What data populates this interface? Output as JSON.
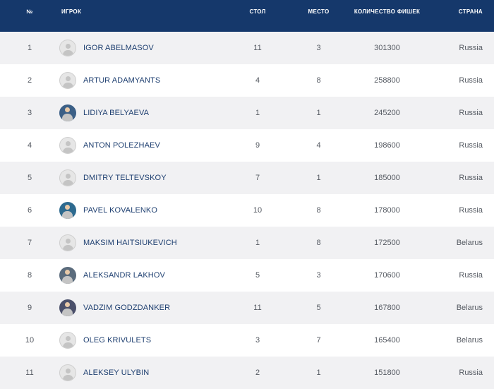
{
  "headers": {
    "rank": "№",
    "player": "ИГРОК",
    "table": "СТОЛ",
    "seat": "МЕСТО",
    "chips": "КОЛИЧЕСТВО ФИШЕК",
    "country": "СТРАНА"
  },
  "rows": [
    {
      "rank": "1",
      "name": "IGOR ABELMASOV",
      "table": "11",
      "seat": "3",
      "chips": "301300",
      "country": "Russia",
      "avatar": "placeholder"
    },
    {
      "rank": "2",
      "name": "ARTUR ADAMYANTS",
      "table": "4",
      "seat": "8",
      "chips": "258800",
      "country": "Russia",
      "avatar": "placeholder"
    },
    {
      "rank": "3",
      "name": "LIDIYA BELYAEVA",
      "table": "1",
      "seat": "1",
      "chips": "245200",
      "country": "Russia",
      "avatar": "photo"
    },
    {
      "rank": "4",
      "name": "ANTON POLEZHAEV",
      "table": "9",
      "seat": "4",
      "chips": "198600",
      "country": "Russia",
      "avatar": "placeholder"
    },
    {
      "rank": "5",
      "name": "DMITRY TELTEVSKOY",
      "table": "7",
      "seat": "1",
      "chips": "185000",
      "country": "Russia",
      "avatar": "placeholder"
    },
    {
      "rank": "6",
      "name": "PAVEL KOVALENKO",
      "table": "10",
      "seat": "8",
      "chips": "178000",
      "country": "Russia",
      "avatar": "photo"
    },
    {
      "rank": "7",
      "name": "MAKSIM HAITSIUKEVICH",
      "table": "1",
      "seat": "8",
      "chips": "172500",
      "country": "Belarus",
      "avatar": "placeholder"
    },
    {
      "rank": "8",
      "name": "ALEKSANDR LAKHOV",
      "table": "5",
      "seat": "3",
      "chips": "170600",
      "country": "Russia",
      "avatar": "photo"
    },
    {
      "rank": "9",
      "name": "VADZIM GODZDANKER",
      "table": "11",
      "seat": "5",
      "chips": "167800",
      "country": "Belarus",
      "avatar": "photo"
    },
    {
      "rank": "10",
      "name": "OLEG KRIVULETS",
      "table": "3",
      "seat": "7",
      "chips": "165400",
      "country": "Belarus",
      "avatar": "placeholder"
    },
    {
      "rank": "11",
      "name": "ALEKSEY ULYBIN",
      "table": "2",
      "seat": "1",
      "chips": "151800",
      "country": "Russia",
      "avatar": "placeholder"
    }
  ],
  "colors": {
    "header_bg": "#15386b",
    "row_alt_bg": "#f1f1f3",
    "name_text": "#1e3f70",
    "cell_text": "#555a62",
    "photo_avatar_colors": [
      "#3b5f86",
      "#2d6a8f",
      "#5a6b7c",
      "#4a4f6a"
    ]
  }
}
